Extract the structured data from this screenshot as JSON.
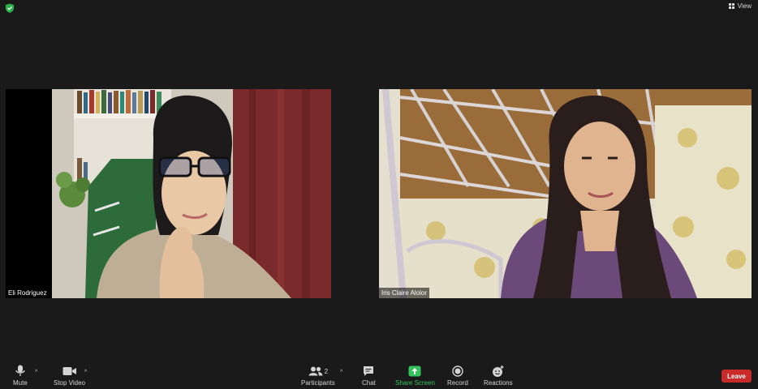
{
  "top": {
    "view_label": "View"
  },
  "participants_tiles": [
    {
      "name": "Eli Rodriguez"
    },
    {
      "name": "Iris Claire Alolor"
    }
  ],
  "toolbar": {
    "mute": "Mute",
    "stop_video": "Stop Video",
    "participants": "Participants",
    "participants_count": "2",
    "chat": "Chat",
    "share_screen": "Share Screen",
    "record": "Record",
    "reactions": "Reactions",
    "leave": "Leave"
  },
  "colors": {
    "background": "#1a1a1a",
    "share_green": "#36c25d",
    "leave_red": "#c92a2a",
    "secure_green": "#29b34a"
  }
}
